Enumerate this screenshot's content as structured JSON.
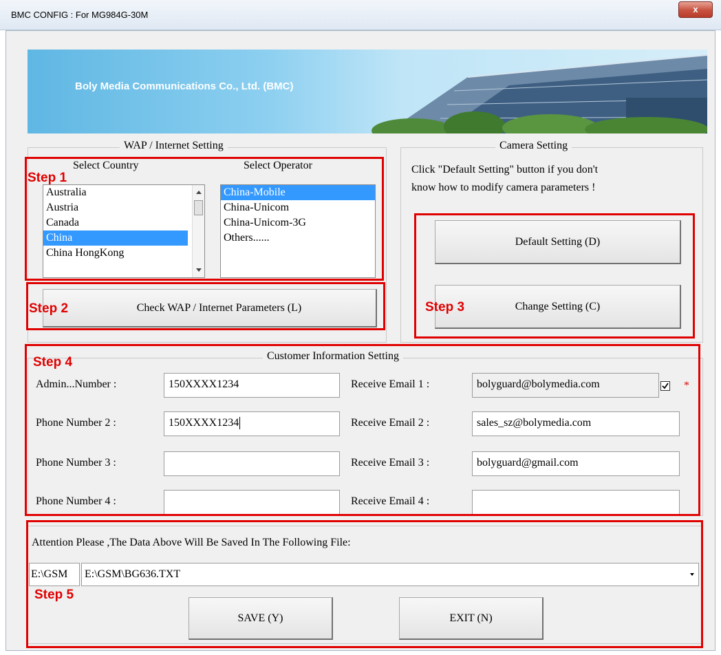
{
  "window": {
    "title": "BMC CONFIG : For MG984G-30M",
    "close_label": "x"
  },
  "banner": {
    "text": "Boly Media Communications Co., Ltd. (BMC)"
  },
  "wap": {
    "title": "WAP / Internet Setting",
    "country_label": "Select Country",
    "operator_label": "Select Operator",
    "countries": [
      "Australia",
      "Austria",
      "Canada",
      "China",
      "China HongKong"
    ],
    "selected_country": "China",
    "operators": [
      "China-Mobile",
      "China-Unicom",
      "China-Unicom-3G",
      "Others......"
    ],
    "selected_operator": "China-Mobile",
    "check_button": "Check WAP / Internet Parameters (L)"
  },
  "camera": {
    "title": "Camera Setting",
    "hint_line1": "Click \"Default Setting\" button if you don't",
    "hint_line2": "know how to modify camera parameters !",
    "default_button": "Default Setting (D)",
    "change_button": "Change Setting (C)"
  },
  "customer": {
    "title": "Customer Information Setting",
    "phone_labels": [
      "Admin...Number :",
      "Phone Number 2 :",
      "Phone Number 3 :",
      "Phone Number 4 :"
    ],
    "phone_values": [
      "150XXXX1234",
      "150XXXX1234",
      "",
      ""
    ],
    "email_labels": [
      "Receive Email 1 :",
      "Receive Email 2 :",
      "Receive Email 3 :",
      "Receive Email 4 :"
    ],
    "email_values": [
      "bolyguard@bolymedia.com",
      "sales_sz@bolymedia.com",
      "bolyguard@gmail.com",
      ""
    ],
    "required_mark": "*"
  },
  "file": {
    "attention": "Attention Please ,The Data Above Will Be Saved In The Following  File:",
    "short_path": "E:\\GSM",
    "path": "E:\\GSM\\BG636.TXT"
  },
  "buttons": {
    "save": "SAVE (Y)",
    "exit": "EXIT (N)"
  },
  "steps": [
    "Step 1",
    "Step 2",
    "Step 3",
    "Step 4",
    "Step 5"
  ],
  "colors": {
    "annotation_red": "#e00000",
    "selection_blue": "#3399ff",
    "dialog_bg": "#f0f0f0"
  }
}
